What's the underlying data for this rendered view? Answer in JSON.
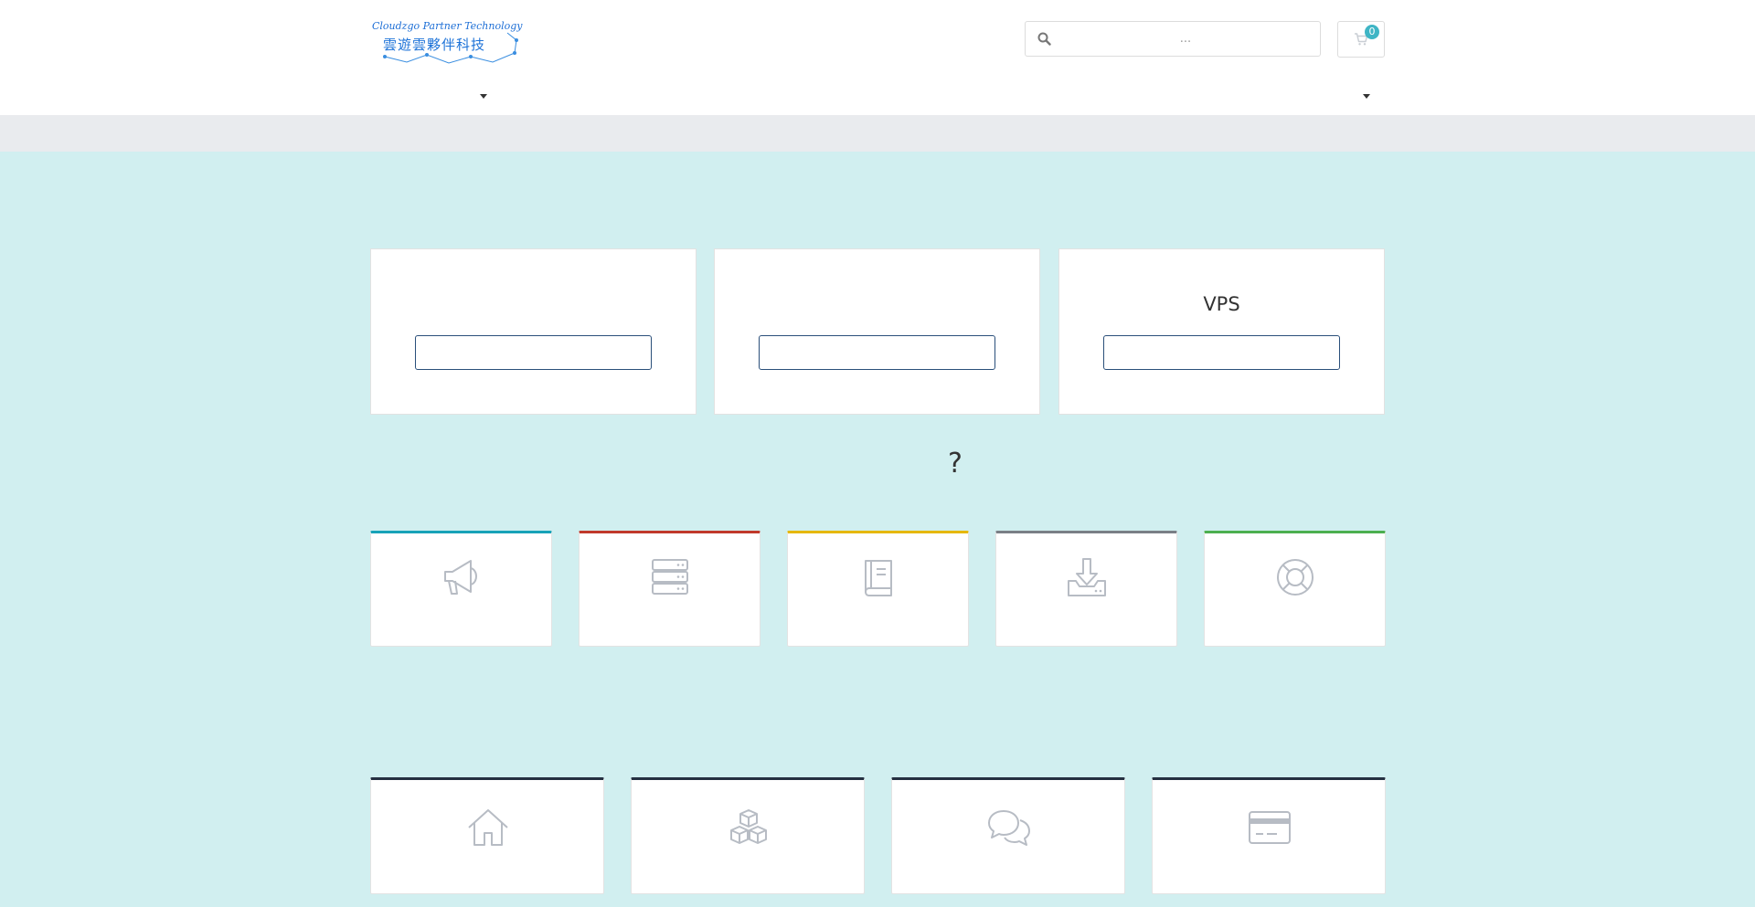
{
  "header": {
    "logo": {
      "text_en": "Cloudzgo Partner Technology",
      "text_zh": "雲遊雲夥伴科技"
    },
    "search": {
      "placeholder": "..."
    },
    "cart": {
      "count": "0"
    }
  },
  "panels": [
    {
      "title": "",
      "button_label": ""
    },
    {
      "title": "",
      "button_label": ""
    },
    {
      "title": "VPS",
      "button_label": ""
    }
  ],
  "question_heading": "?",
  "quick_links": [
    {
      "icon": "megaphone-icon",
      "accent": "#17a2b8"
    },
    {
      "icon": "server-icon",
      "accent": "#c0392b"
    },
    {
      "icon": "book-icon",
      "accent": "#e6b800"
    },
    {
      "icon": "download-icon",
      "accent": "#7a7f86"
    },
    {
      "icon": "lifebuoy-icon",
      "accent": "#4caf50"
    }
  ],
  "account_links": [
    {
      "icon": "home-icon"
    },
    {
      "icon": "cubes-icon"
    },
    {
      "icon": "chat-icon"
    },
    {
      "icon": "credit-card-icon"
    }
  ],
  "colors": {
    "page_bg": "#d1eff0",
    "subbar_bg": "#e9ebee",
    "icon_gray": "#b7bcc4",
    "button_border": "#2a4f7a",
    "cart_badge": "#3fb5c5",
    "account_tile_accent": "#253041"
  }
}
